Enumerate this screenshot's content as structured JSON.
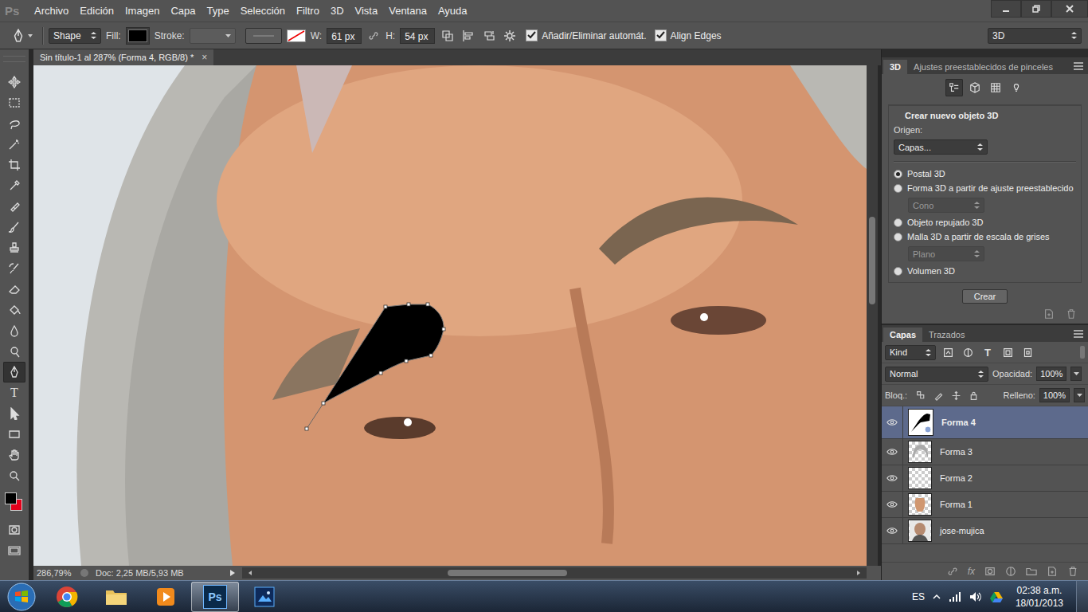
{
  "app": {
    "logo": "Ps"
  },
  "menu": [
    "Archivo",
    "Edición",
    "Imagen",
    "Capa",
    "Type",
    "Selección",
    "Filtro",
    "3D",
    "Vista",
    "Ventana",
    "Ayuda"
  ],
  "options_bar": {
    "mode": "Shape",
    "fill_label": "Fill:",
    "stroke_label": "Stroke:",
    "width_label": "W:",
    "width_value": "61 px",
    "height_label": "H:",
    "height_value": "54 px",
    "checkboxes": [
      {
        "label": "Añadir/Eliminar automát.",
        "checked": true
      },
      {
        "label": "Align Edges",
        "checked": true
      }
    ],
    "workspace": "3D"
  },
  "document": {
    "tab_title": "Sin título-1 al 287% (Forma 4, RGB/8) *",
    "close": "×"
  },
  "tools": [
    {
      "kind": "move",
      "selected": false
    },
    {
      "kind": "marquee",
      "selected": false
    },
    {
      "kind": "lasso",
      "selected": false
    },
    {
      "kind": "wand",
      "selected": false
    },
    {
      "kind": "crop",
      "selected": false
    },
    {
      "kind": "eyedropper",
      "selected": false
    },
    {
      "kind": "healing",
      "selected": false
    },
    {
      "kind": "brush",
      "selected": false
    },
    {
      "kind": "stamp",
      "selected": false
    },
    {
      "kind": "history",
      "selected": false
    },
    {
      "kind": "eraser",
      "selected": false
    },
    {
      "kind": "bucket",
      "selected": false
    },
    {
      "kind": "blur",
      "selected": false
    },
    {
      "kind": "dodge",
      "selected": false
    },
    {
      "kind": "pen",
      "selected": true
    },
    {
      "kind": "type",
      "selected": false,
      "glyph": "T"
    },
    {
      "kind": "path-select",
      "selected": false
    },
    {
      "kind": "rectangle",
      "selected": false
    },
    {
      "kind": "hand",
      "selected": false
    },
    {
      "kind": "zoom",
      "selected": false
    }
  ],
  "swatches": [
    {
      "kind": "foreground",
      "color": "#000000"
    },
    {
      "kind": "background",
      "color": "#e3001b"
    }
  ],
  "status_bar": {
    "zoom": "286,79%",
    "doc_size": "Doc: 2,25 MB/5,93 MB"
  },
  "panel_3d": {
    "tabs": [
      {
        "label": "3D",
        "selected": true
      },
      {
        "label": "Ajustes preestablecidos de pinceles",
        "selected": false
      }
    ],
    "views": [
      {
        "kind": "scene",
        "selected": true
      },
      {
        "kind": "mesh",
        "selected": false
      },
      {
        "kind": "material",
        "selected": false
      },
      {
        "kind": "light",
        "selected": false
      }
    ],
    "title": "Crear nuevo objeto 3D",
    "origin_label": "Origen:",
    "origin_value": "Capas...",
    "options": [
      {
        "kind": "radio",
        "label": "Postal 3D",
        "selected": true,
        "disabled": false
      },
      {
        "kind": "radio",
        "label": "Forma 3D a partir de ajuste preestablecido",
        "selected": false,
        "disabled": false
      },
      {
        "kind": "select",
        "label": "Cono",
        "selected": false,
        "disabled": true
      },
      {
        "kind": "radio",
        "label": "Objeto repujado 3D",
        "selected": false,
        "disabled": false
      },
      {
        "kind": "radio",
        "label": "Malla 3D a partir de escala de grises",
        "selected": false,
        "disabled": false
      },
      {
        "kind": "select",
        "label": "Plano",
        "selected": false,
        "disabled": true
      },
      {
        "kind": "radio",
        "label": "Volumen 3D",
        "selected": false,
        "disabled": false
      }
    ],
    "button": "Crear"
  },
  "layers_panel": {
    "tabs": [
      {
        "label": "Capas",
        "selected": true
      },
      {
        "label": "Trazados",
        "selected": false
      }
    ],
    "filter": "Kind",
    "filter_icons": [
      {
        "kind": "pixel"
      },
      {
        "kind": "adjustment"
      },
      {
        "kind": "type",
        "glyph": "T"
      },
      {
        "kind": "shape"
      },
      {
        "kind": "smart"
      }
    ],
    "blend_mode": "Normal",
    "opacity_label": "Opacidad:",
    "opacity": "100%",
    "lock_label": "Bloq.:",
    "fill_label": "Relleno:",
    "fill": "100%",
    "layers": [
      {
        "name": "Forma 4",
        "visible": true,
        "selected": true,
        "thumb": "shape"
      },
      {
        "name": "Forma 3",
        "visible": true,
        "selected": false,
        "thumb": "hair"
      },
      {
        "name": "Forma 2",
        "visible": true,
        "selected": false,
        "thumb": "empty"
      },
      {
        "name": "Forma 1",
        "visible": true,
        "selected": false,
        "thumb": "skin"
      },
      {
        "name": "jose-mujica",
        "visible": true,
        "selected": false,
        "thumb": "photo"
      }
    ],
    "footer": [
      {
        "kind": "link"
      },
      {
        "kind": "fx",
        "glyph": "fx"
      },
      {
        "kind": "mask"
      },
      {
        "kind": "adjustment"
      },
      {
        "kind": "group"
      },
      {
        "kind": "new"
      },
      {
        "kind": "trash"
      }
    ]
  },
  "taskbar": {
    "apps": [
      {
        "kind": "chrome",
        "active": false
      },
      {
        "kind": "explorer",
        "active": false
      },
      {
        "kind": "media",
        "active": false
      },
      {
        "kind": "photoshop",
        "active": true,
        "glyph": "Ps"
      },
      {
        "kind": "other",
        "active": false
      }
    ],
    "language": "ES",
    "time": "02:38 a.m.",
    "date": "18/01/2013"
  }
}
